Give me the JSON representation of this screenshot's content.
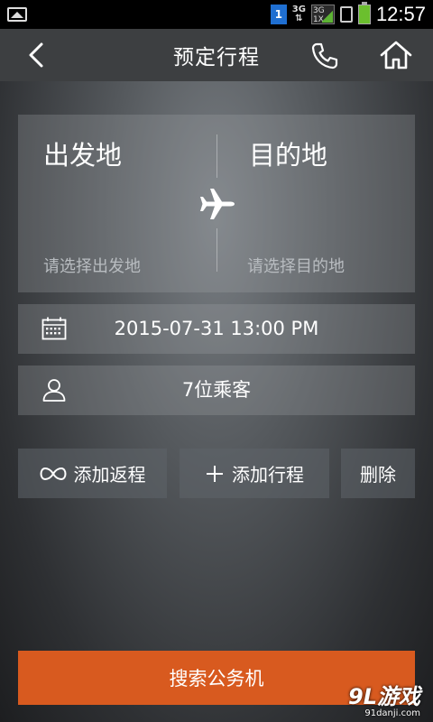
{
  "status_bar": {
    "time": "12:57",
    "sim_badge": "1",
    "net1": "3G",
    "net2_top": "3G",
    "net2_bottom": "1X"
  },
  "navbar": {
    "title": "预定行程"
  },
  "route": {
    "from_label": "出发地",
    "from_placeholder": "请选择出发地",
    "to_label": "目的地",
    "to_placeholder": "请选择目的地"
  },
  "date": {
    "value": "2015-07-31 13:00 PM"
  },
  "passengers": {
    "value": "7位乘客"
  },
  "actions": {
    "add_return": "添加返程",
    "add_trip": "添加行程",
    "delete": "删除"
  },
  "search": {
    "label": "搜索公务机"
  },
  "watermark": {
    "logo": "9L游戏",
    "url": "91danji.com"
  },
  "colors": {
    "accent": "#d85a1f",
    "navbar": "#3d3f41"
  }
}
